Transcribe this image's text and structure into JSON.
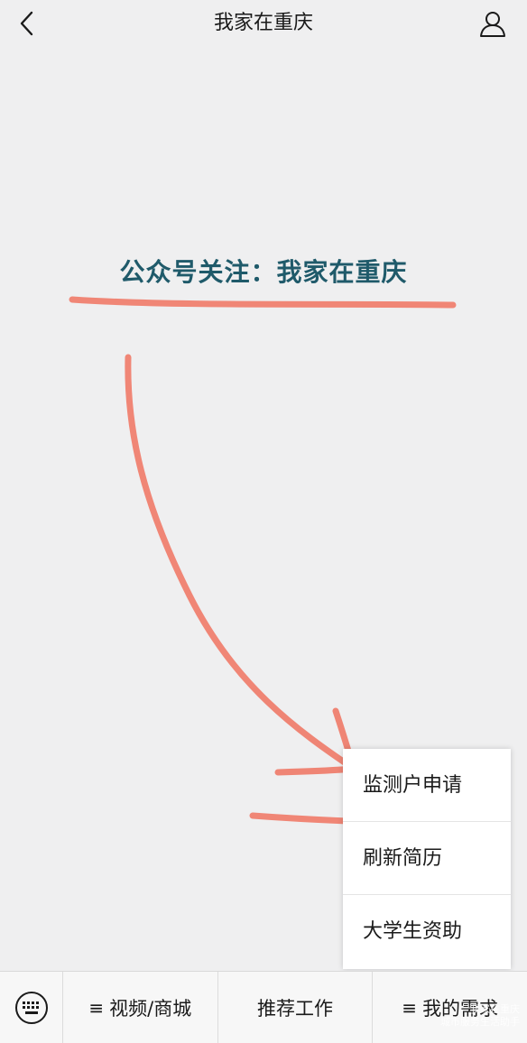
{
  "topbar": {
    "title": "我家在重庆",
    "back_icon": "chevron-left-icon",
    "profile_icon": "person-icon"
  },
  "content": {
    "banner_text": "公众号关注：我家在重庆",
    "banner_color": "#1f5a6a",
    "annotation_color": "#f07a68"
  },
  "popup_menu": {
    "items": [
      {
        "label": "监测户申请"
      },
      {
        "label": "刷新简历"
      },
      {
        "label": "大学生资助"
      }
    ]
  },
  "bottom_menu": {
    "keyboard_icon": "keyboard-icon",
    "menu_glyph": "≡",
    "items": [
      {
        "label": "视频/商城",
        "has_glyph": true
      },
      {
        "label": "推荐工作",
        "has_glyph": false
      },
      {
        "label": "我的需求",
        "has_glyph": true
      }
    ]
  },
  "watermark": {
    "line1": "我家在重庆",
    "line2": "城市服务生活助手"
  }
}
